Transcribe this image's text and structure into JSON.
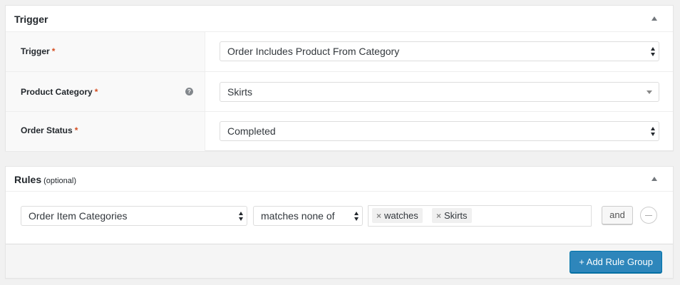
{
  "trigger_panel": {
    "title": "Trigger",
    "fields": [
      {
        "label": "Trigger",
        "required_mark": "*",
        "value": "Order Includes Product From Category"
      },
      {
        "label": "Product Category",
        "required_mark": "*",
        "help_icon": "?",
        "value": "Skirts"
      },
      {
        "label": "Order Status",
        "required_mark": "*",
        "value": "Completed"
      }
    ]
  },
  "rules_panel": {
    "title": "Rules",
    "title_suffix": "(optional)",
    "rule": {
      "field": "Order Item Categories",
      "operator": "matches none of",
      "tags": [
        "watches",
        "Skirts"
      ],
      "tag_remove": "×",
      "and_button": "and"
    },
    "add_group_button": "+ Add Rule Group"
  },
  "colors": {
    "primary_button": "#2e86bb",
    "required": "#d54e21"
  }
}
